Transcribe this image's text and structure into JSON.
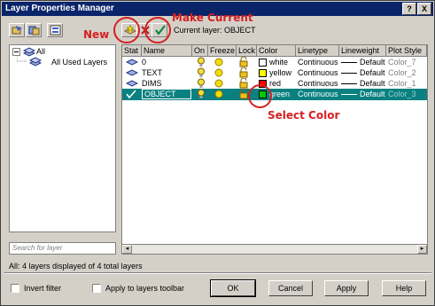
{
  "window": {
    "title": "Layer Properties Manager",
    "help_button": "?",
    "close_button": "X"
  },
  "toolbar": {
    "current_layer_label": "Current layer: OBJECT"
  },
  "annotations": {
    "new": "New",
    "make_current": "Make Current",
    "select_color": "Select Color",
    "color": "#d42020"
  },
  "tree": {
    "root": "All",
    "child": "All Used Layers"
  },
  "search": {
    "placeholder": "Search for layer"
  },
  "grid": {
    "columns": [
      "Stat",
      "Name",
      "On",
      "Freeze",
      "Lock",
      "Color",
      "Linetype",
      "Lineweight",
      "Plot Style"
    ],
    "rows": [
      {
        "name": "0",
        "color_name": "white",
        "color_hex": "#ffffff",
        "linetype": "Continuous",
        "lineweight": "Default",
        "plot_style": "Color_7",
        "current": false,
        "selected": false
      },
      {
        "name": "TEXT",
        "color_name": "yellow",
        "color_hex": "#ffff00",
        "linetype": "Continuous",
        "lineweight": "Default",
        "plot_style": "Color_2",
        "current": false,
        "selected": false
      },
      {
        "name": "DIMS",
        "color_name": "red",
        "color_hex": "#ff0000",
        "linetype": "Continuous",
        "lineweight": "Default",
        "plot_style": "Color_1",
        "current": false,
        "selected": false
      },
      {
        "name": "OBJECT",
        "color_name": "green",
        "color_hex": "#00cc00",
        "linetype": "Continuous",
        "lineweight": "Default",
        "plot_style": "Color_3",
        "current": true,
        "selected": true
      }
    ],
    "selection_color": "#0a8080"
  },
  "status": {
    "text": "All: 4 layers displayed of 4 total layers"
  },
  "options": {
    "invert_filter": "Invert filter",
    "apply_to_toolbar": "Apply to layers toolbar"
  },
  "buttons": {
    "ok": "OK",
    "cancel": "Cancel",
    "apply": "Apply",
    "help": "Help"
  }
}
